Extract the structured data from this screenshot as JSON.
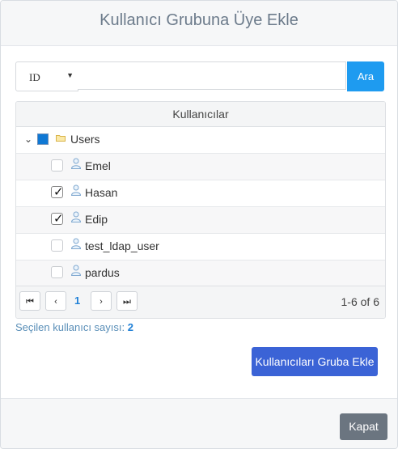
{
  "dialog": {
    "title": "Kullanıcı Grubuna Üye Ekle"
  },
  "search": {
    "field_value": "ID",
    "query_value": "",
    "placeholder": "",
    "button_label": "Ara"
  },
  "grid": {
    "column_header": "Kullanıcılar",
    "group": {
      "label": "Users",
      "expanded": true,
      "caret": "⌄"
    },
    "users": [
      {
        "name": "Emel",
        "checked": false
      },
      {
        "name": "Hasan",
        "checked": true
      },
      {
        "name": "Edip",
        "checked": true
      },
      {
        "name": "test_ldap_user",
        "checked": false
      },
      {
        "name": "pardus",
        "checked": false
      }
    ],
    "pager": {
      "first": "⏮",
      "prev": "‹",
      "page": "1",
      "next": "›",
      "last": "⏭",
      "range": "1-6 of 6"
    }
  },
  "selection": {
    "label": "Seçilen kullanıcı sayısı:",
    "count": "2"
  },
  "actions": {
    "add_label": "Kullanıcıları Gruba Ekle",
    "close_label": "Kapat"
  },
  "colors": {
    "primary": "#3b63d6",
    "search_button": "#1e9bf0",
    "close_button": "#6b7580",
    "link": "#1e7fd6"
  }
}
